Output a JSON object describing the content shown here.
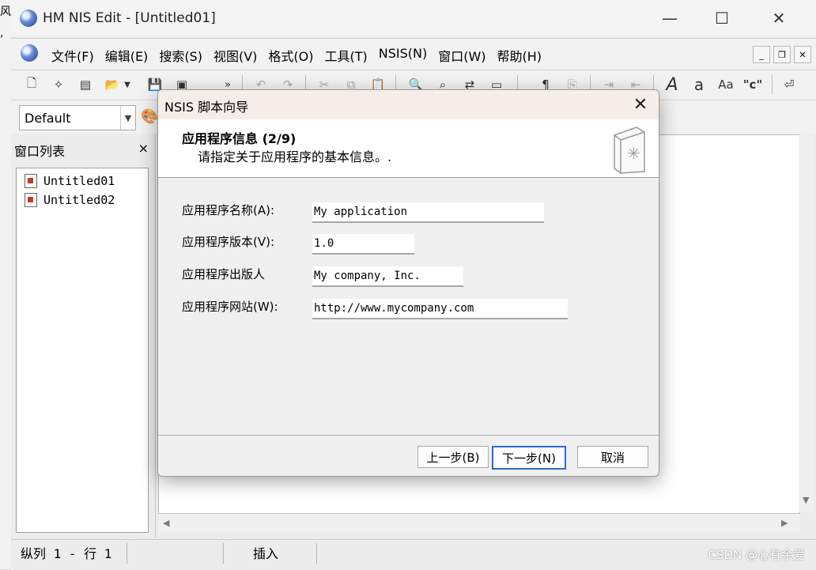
{
  "window": {
    "title": "HM NIS Edit - [Untitled01]"
  },
  "menu": [
    "文件(F)",
    "编辑(E)",
    "搜索(S)",
    "视图(V)",
    "格式(O)",
    "工具(T)",
    "NSIS(N)",
    "窗口(W)",
    "帮助(H)"
  ],
  "toolbar2": {
    "style_combo": "Default"
  },
  "window_list": {
    "title": "窗口列表",
    "close": "×",
    "items": [
      "Untitled01",
      "Untitled02"
    ]
  },
  "status": {
    "position": "纵列 1 - 行 1",
    "mode": "插入",
    "watermark": "CSDN @心有余爱"
  },
  "dialog": {
    "title": "NSIS 脚本向导",
    "header_title": "应用程序信息 (2/9)",
    "header_subtitle": "请指定关于应用程序的基本信息。.",
    "fields": [
      {
        "label": "应用程序名称(A):",
        "value": "My application"
      },
      {
        "label": "应用程序版本(V):",
        "value": "1.0"
      },
      {
        "label": "应用程序出版人",
        "value": "My company, Inc."
      },
      {
        "label": "应用程序网站(W):",
        "value": "http://www.mycompany.com"
      }
    ],
    "buttons": {
      "back": "上一步(B)",
      "next": "下一步(N)",
      "cancel": "取消"
    }
  }
}
